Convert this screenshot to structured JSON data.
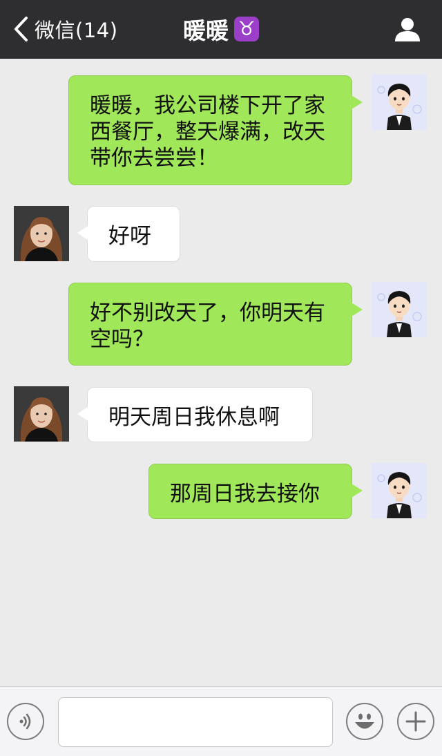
{
  "navbar": {
    "back_label": "微信(14)",
    "title": "暖暖",
    "zodiac_symbol": "♉",
    "zodiac_icon": "taurus-icon"
  },
  "messages": [
    {
      "side": "sent",
      "text": "暖暖，我公司楼下开了家西餐厅，整天爆满，改天带你去尝尝！"
    },
    {
      "side": "received",
      "text": "好呀"
    },
    {
      "side": "sent",
      "text": "好不别改天了，你明天有空吗？"
    },
    {
      "side": "received",
      "text": "明天周日我休息啊"
    },
    {
      "side": "sent",
      "text": "那周日我去接你"
    }
  ],
  "input_bar": {
    "voice_icon": "voice-icon",
    "text_value": "",
    "emoji_icon": "smiley-icon",
    "add_icon": "plus-icon"
  },
  "colors": {
    "navbar_bg": "#2e2e30",
    "chat_bg": "#ebebeb",
    "sent_bubble": "#a0e75a",
    "received_bubble": "#ffffff"
  }
}
